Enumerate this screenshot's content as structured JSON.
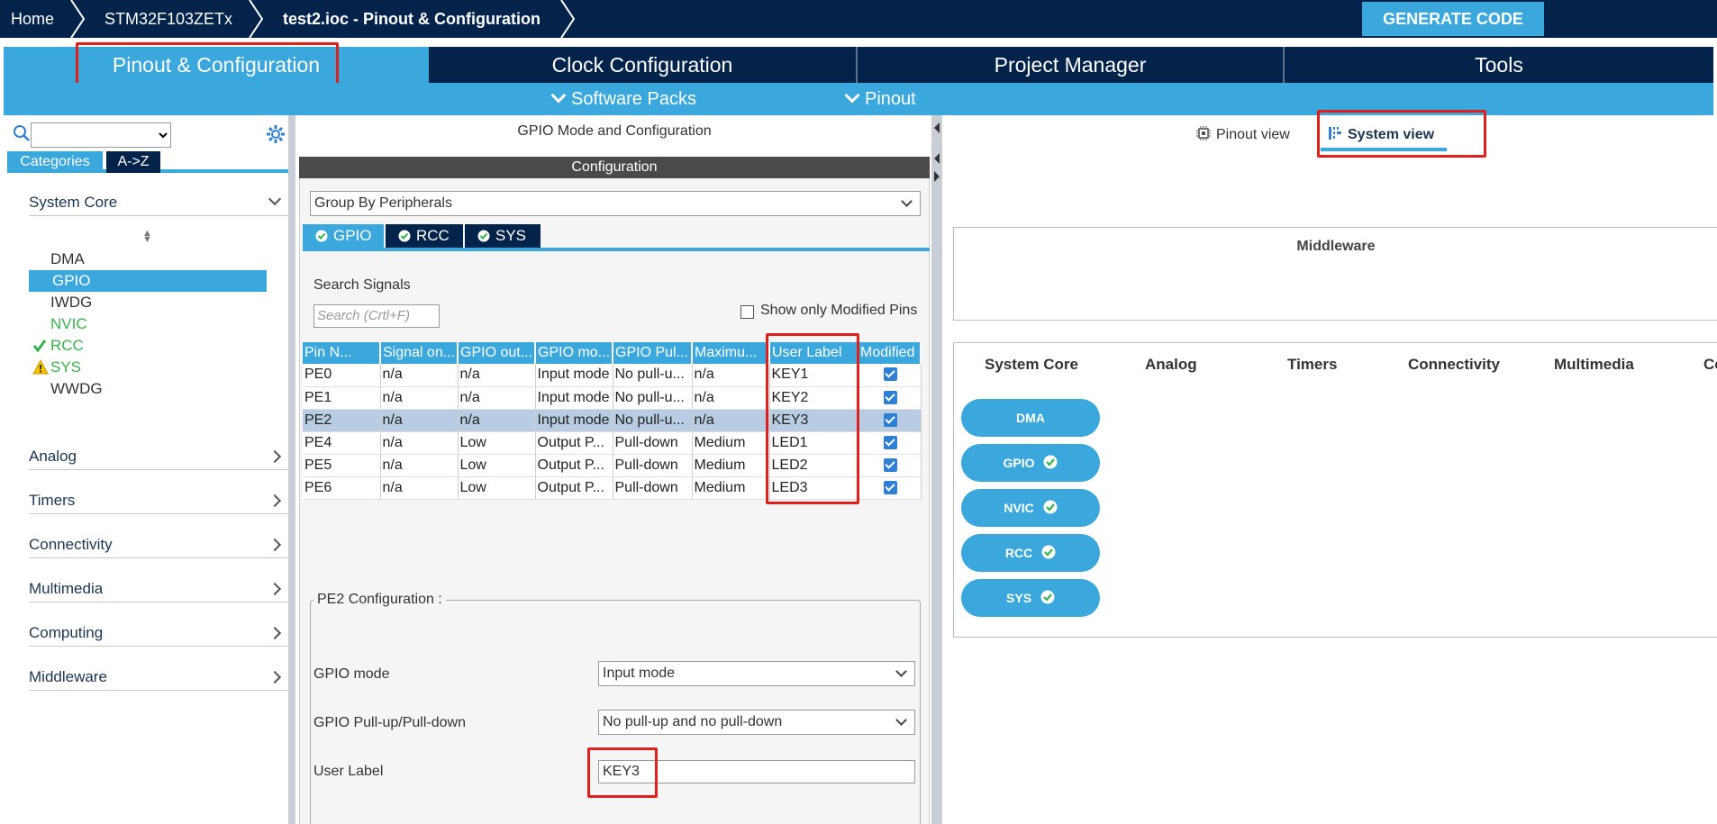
{
  "breadcrumb": {
    "home": "Home",
    "mcu": "STM32F103ZETx",
    "file": "test2.ioc - Pinout & Configuration"
  },
  "generate_button": "GENERATE CODE",
  "main_tabs": {
    "pinout": "Pinout & Configuration",
    "clock": "Clock Configuration",
    "project": "Project Manager",
    "tools": "Tools"
  },
  "sub_bar": {
    "software_packs": "Software Packs",
    "pinout": "Pinout"
  },
  "left_panel": {
    "search_value": "",
    "tabs": {
      "categories": "Categories",
      "az": "A->Z"
    },
    "groups": {
      "system_core": "System Core",
      "analog": "Analog",
      "timers": "Timers",
      "connectivity": "Connectivity",
      "multimedia": "Multimedia",
      "computing": "Computing",
      "middleware": "Middleware"
    },
    "peripherals": {
      "dma": "DMA",
      "gpio": "GPIO",
      "iwdg": "IWDG",
      "nvic": "NVIC",
      "rcc": "RCC",
      "sys": "SYS",
      "wwdg": "WWDG"
    },
    "selected_peripheral": "GPIO"
  },
  "middle_panel": {
    "title": "GPIO Mode and Configuration",
    "configuration_header": "Configuration",
    "group_by": "Group By Peripherals",
    "ip_tabs": {
      "gpio": "GPIO",
      "rcc": "RCC",
      "sys": "SYS"
    },
    "search_signals_label": "Search Signals",
    "search_placeholder": "Search (Crtl+F)",
    "show_modified_label": "Show only Modified Pins",
    "show_modified_checked": false,
    "table": {
      "headers": [
        "Pin N...",
        "Signal on...",
        "GPIO out...",
        "GPIO mo...",
        "GPIO Pul...",
        "Maximu...",
        "User Label",
        "Modified"
      ],
      "rows": [
        {
          "pin": "PE0",
          "signal": "n/a",
          "output": "n/a",
          "mode": "Input mode",
          "pull": "No pull-u...",
          "speed": "n/a",
          "label": "KEY1",
          "modified": true
        },
        {
          "pin": "PE1",
          "signal": "n/a",
          "output": "n/a",
          "mode": "Input mode",
          "pull": "No pull-u...",
          "speed": "n/a",
          "label": "KEY2",
          "modified": true
        },
        {
          "pin": "PE2",
          "signal": "n/a",
          "output": "n/a",
          "mode": "Input mode",
          "pull": "No pull-u...",
          "speed": "n/a",
          "label": "KEY3",
          "modified": true
        },
        {
          "pin": "PE4",
          "signal": "n/a",
          "output": "Low",
          "mode": "Output P...",
          "pull": "Pull-down",
          "speed": "Medium",
          "label": "LED1",
          "modified": true
        },
        {
          "pin": "PE5",
          "signal": "n/a",
          "output": "Low",
          "mode": "Output P...",
          "pull": "Pull-down",
          "speed": "Medium",
          "label": "LED2",
          "modified": true
        },
        {
          "pin": "PE6",
          "signal": "n/a",
          "output": "Low",
          "mode": "Output P...",
          "pull": "Pull-down",
          "speed": "Medium",
          "label": "LED3",
          "modified": true
        }
      ],
      "selected_row": "PE2"
    },
    "pin_config": {
      "legend": "PE2 Configuration :",
      "gpio_mode_label": "GPIO mode",
      "gpio_mode_value": "Input mode",
      "pull_label": "GPIO Pull-up/Pull-down",
      "pull_value": "No pull-up and no pull-down",
      "user_label_label": "User Label",
      "user_label_value": "KEY3"
    }
  },
  "right_panel": {
    "pinout_view": "Pinout view",
    "system_view": "System view",
    "middleware_title": "Middleware",
    "categories": [
      "System Core",
      "Analog",
      "Timers",
      "Connectivity",
      "Multimedia",
      "Co"
    ],
    "ip_buttons": [
      {
        "label": "DMA",
        "ok": false
      },
      {
        "label": "GPIO",
        "ok": true
      },
      {
        "label": "NVIC",
        "ok": true
      },
      {
        "label": "RCC",
        "ok": true
      },
      {
        "label": "SYS",
        "ok": true
      }
    ]
  },
  "colors": {
    "navy": "#03234b",
    "accent_blue": "#3aa7dd",
    "highlight_red": "#e0201b",
    "ok_green": "#35b34a",
    "warn_yellow": "#f2c200"
  }
}
